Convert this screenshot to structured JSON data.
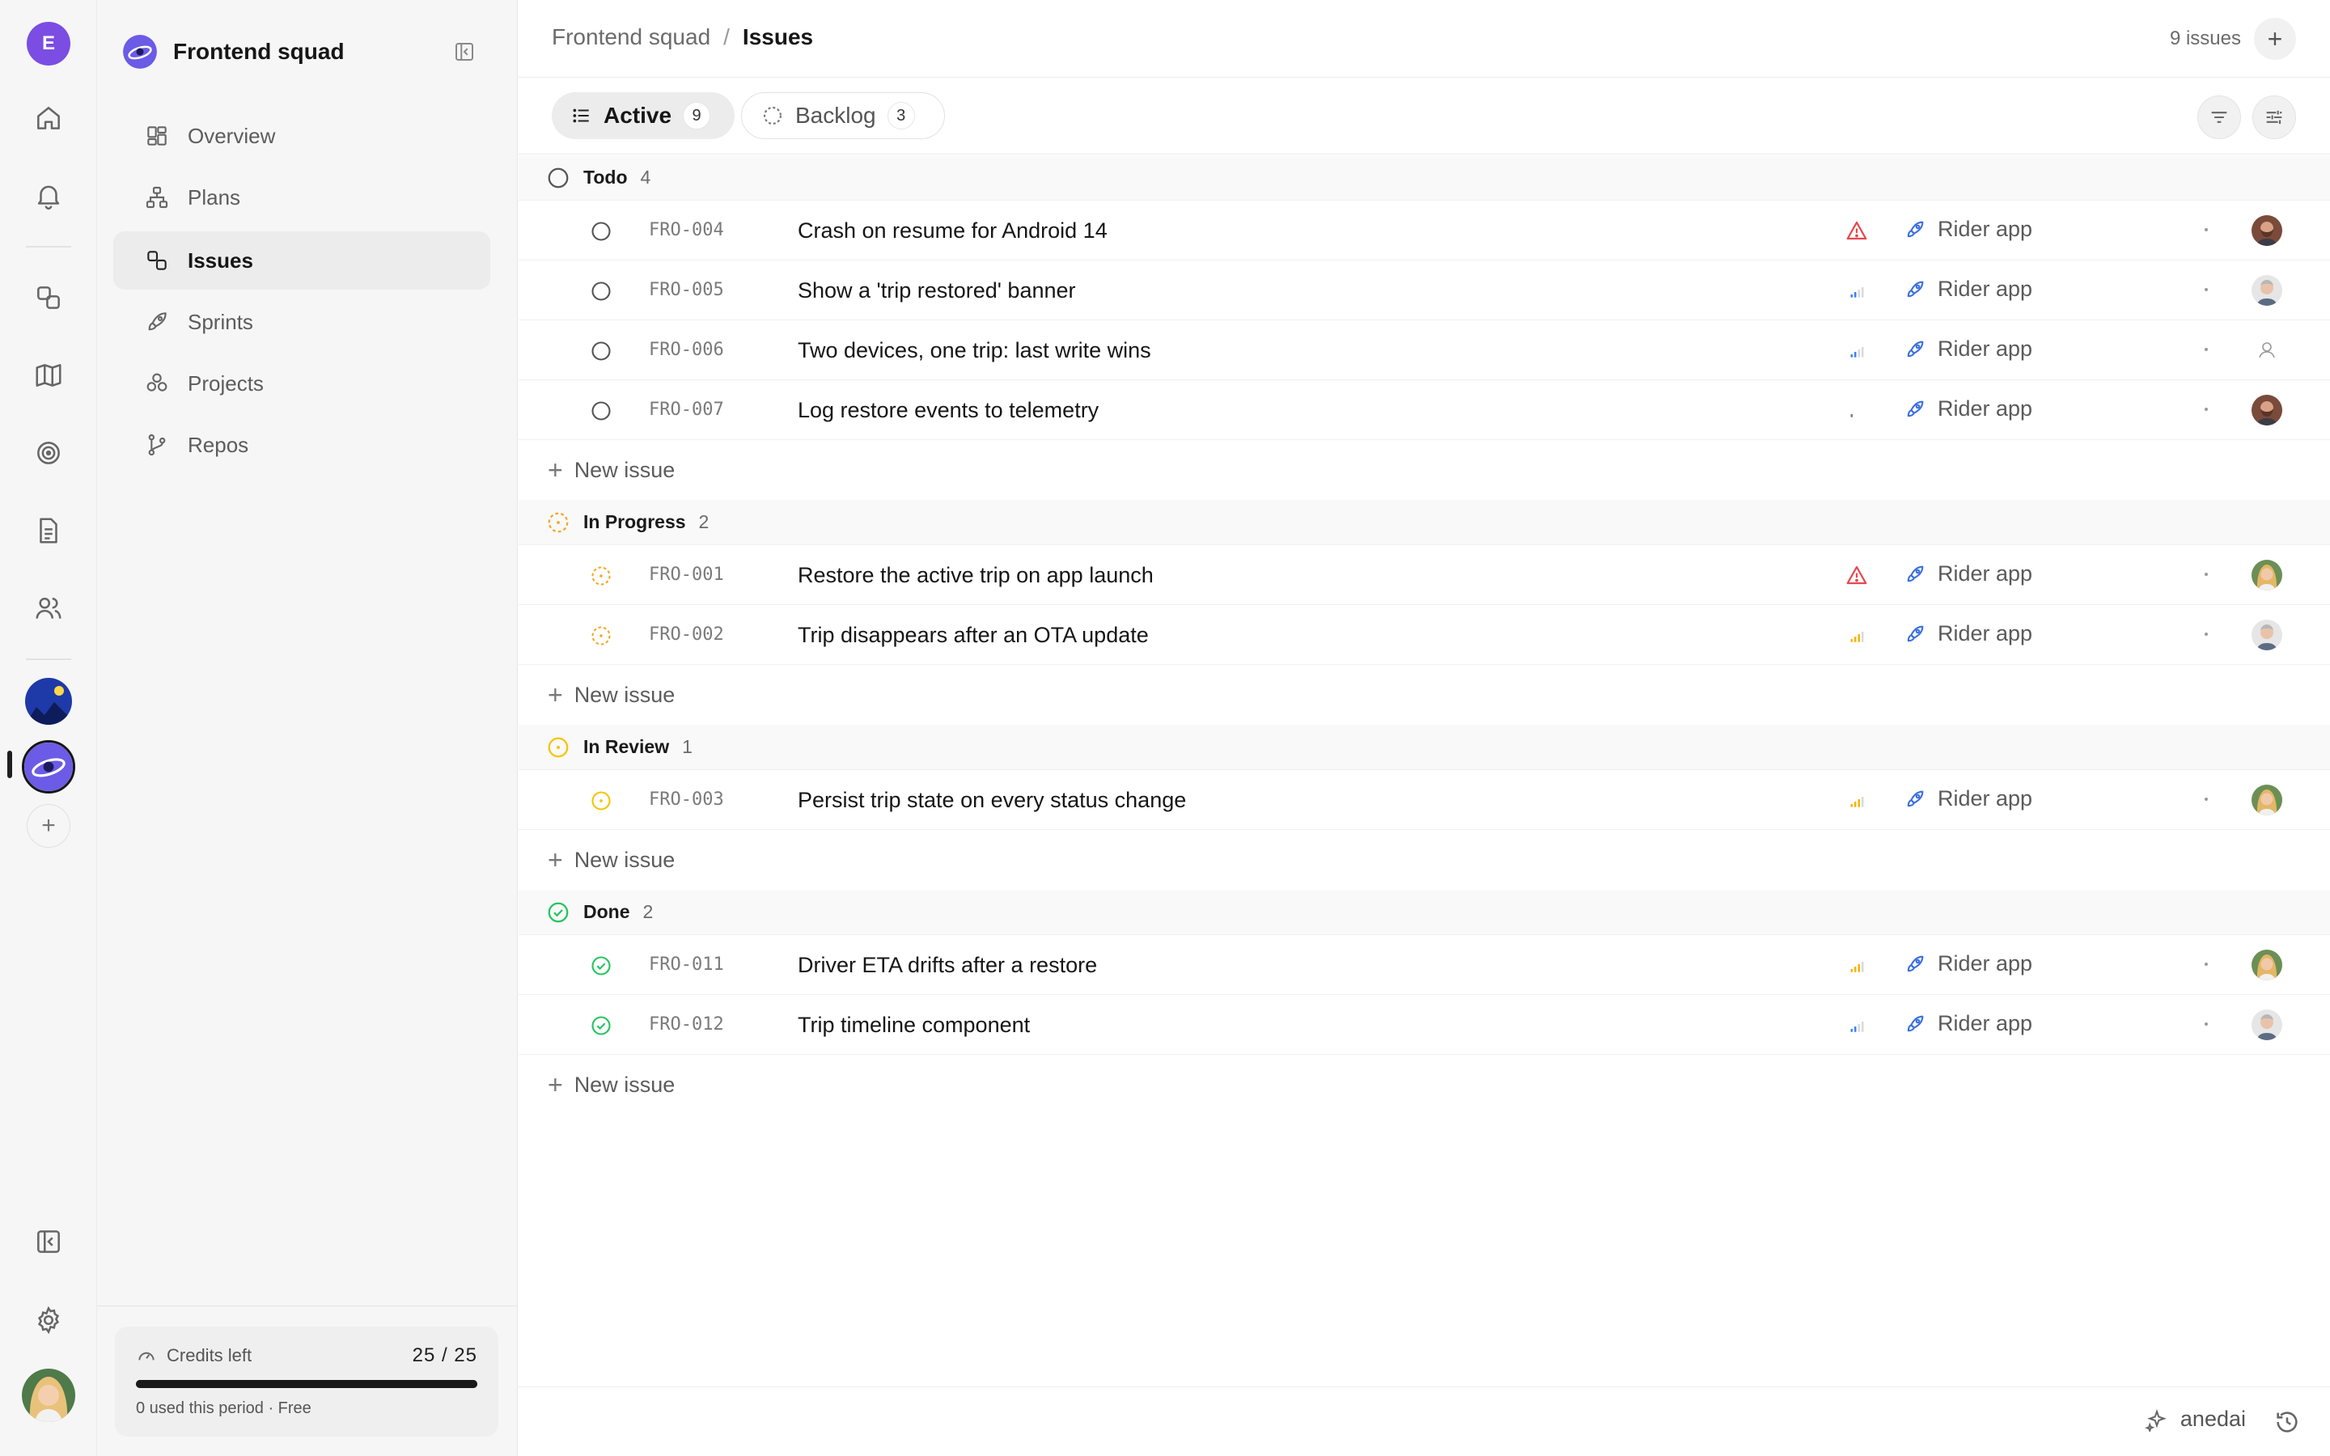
{
  "workspace": {
    "initial": "E"
  },
  "team": {
    "name": "Frontend squad"
  },
  "sidebar": {
    "items": [
      {
        "label": "Overview",
        "icon": "overview-icon"
      },
      {
        "label": "Plans",
        "icon": "plans-icon"
      },
      {
        "label": "Issues",
        "icon": "issues-icon",
        "active": true
      },
      {
        "label": "Sprints",
        "icon": "sprints-icon"
      },
      {
        "label": "Projects",
        "icon": "projects-icon"
      },
      {
        "label": "Repos",
        "icon": "repos-icon"
      }
    ]
  },
  "credits": {
    "label": "Credits left",
    "used": 25,
    "total": 25,
    "value_text": "25 / 25",
    "remaining_fraction": 1.0,
    "note": "0 used this period · Free"
  },
  "header": {
    "breadcrumb_team": "Frontend squad",
    "breadcrumb_sep": "/",
    "breadcrumb_page": "Issues",
    "issue_count": "9 issues"
  },
  "tabs": [
    {
      "label": "Active",
      "count": "9"
    },
    {
      "label": "Backlog",
      "count": "3"
    }
  ],
  "new_issue_label": "New issue",
  "groups": [
    {
      "name": "Todo",
      "count": "4",
      "status": "todo",
      "issues": [
        {
          "id": "FRO-004",
          "title": "Crash on resume for Android 14",
          "priority": "urgent",
          "project": "Rider app",
          "assignee": "man-beard"
        },
        {
          "id": "FRO-005",
          "title": "Show a 'trip restored' banner",
          "priority": "low",
          "project": "Rider app",
          "assignee": "man-grey"
        },
        {
          "id": "FRO-006",
          "title": "Two devices, one trip: last write wins",
          "priority": "low",
          "project": "Rider app",
          "assignee": "unassigned"
        },
        {
          "id": "FRO-007",
          "title": "Log restore events to telemetry",
          "priority": "none",
          "project": "Rider app",
          "assignee": "man-beard"
        }
      ]
    },
    {
      "name": "In Progress",
      "count": "2",
      "status": "progress",
      "issues": [
        {
          "id": "FRO-001",
          "title": "Restore the active trip on app launch",
          "priority": "urgent",
          "project": "Rider app",
          "assignee": "woman-blonde"
        },
        {
          "id": "FRO-002",
          "title": "Trip disappears after an OTA update",
          "priority": "high",
          "project": "Rider app",
          "assignee": "man-grey"
        }
      ]
    },
    {
      "name": "In Review",
      "count": "1",
      "status": "review",
      "issues": [
        {
          "id": "FRO-003",
          "title": "Persist trip state on every status change",
          "priority": "high",
          "project": "Rider app",
          "assignee": "woman-blonde"
        }
      ]
    },
    {
      "name": "Done",
      "count": "2",
      "status": "done",
      "issues": [
        {
          "id": "FRO-011",
          "title": "Driver ETA drifts after a restore",
          "priority": "high",
          "project": "Rider app",
          "assignee": "woman-blonde"
        },
        {
          "id": "FRO-012",
          "title": "Trip timeline component",
          "priority": "low",
          "project": "Rider app",
          "assignee": "man-grey"
        }
      ]
    }
  ],
  "footer": {
    "brand": "anedai"
  },
  "colors": {
    "accent": "#7b4de3",
    "urgent": "#e5484d",
    "priority_low": "#3b82f6",
    "priority_high": "#f5b400",
    "status_progress": "#f5a623",
    "status_review": "#f5c400",
    "status_done": "#22c55e",
    "project_icon": "#3b6fe0"
  }
}
